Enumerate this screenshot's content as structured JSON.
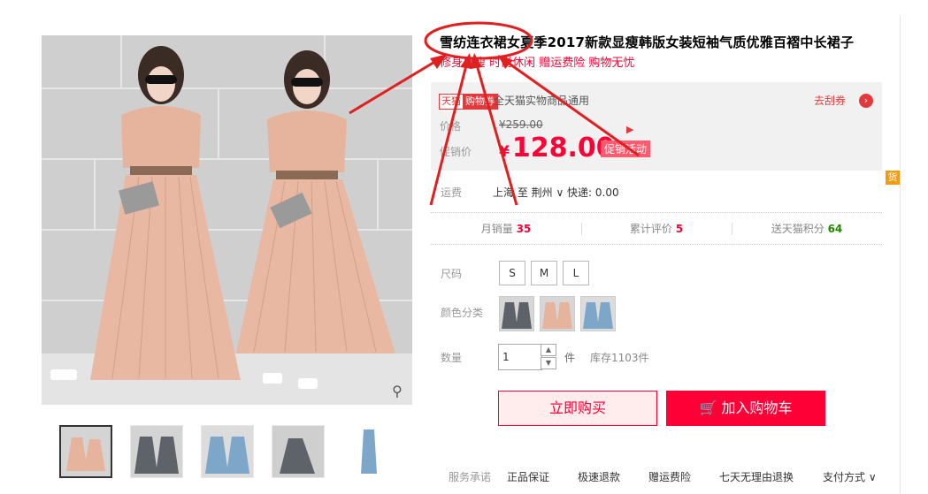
{
  "product": {
    "title": "雪纺连衣裙女夏季2017新款显瘦韩版女装短袖气质优雅百褶中长裙子",
    "subtitle": "修身显瘦 时尚休闲 赠运费险 购物无忧"
  },
  "coupon": {
    "tag_a": "天猫",
    "tag_b": "购物券",
    "text": "全天猫实物商品通用",
    "link": "去刮券"
  },
  "price": {
    "label": "价格",
    "original": "¥259.00",
    "promo_label": "促销价",
    "currency": "¥",
    "promo": "128.00",
    "promo_badge": "促销活动"
  },
  "shipping": {
    "label": "运费",
    "value": "上海 至 荆州 ∨ 快递: 0.00"
  },
  "stats": [
    {
      "label": "月销量",
      "value": "35",
      "color": "#ff0036"
    },
    {
      "label": "累计评价",
      "value": "5",
      "color": "#ff0036"
    },
    {
      "label": "送天猫积分",
      "value": "64",
      "color": "#228800"
    }
  ],
  "sku": {
    "size_label": "尺码",
    "sizes": [
      "S",
      "M",
      "L"
    ],
    "color_label": "颜色分类",
    "qty_label": "数量",
    "qty_value": "1",
    "qty_unit": "件",
    "stock": "库存1103件"
  },
  "actions": {
    "buy_now": "立即购买",
    "add_cart": "加入购物车"
  },
  "services": {
    "label": "服务承诺",
    "items": [
      "正品保证",
      "极速退款",
      "赠运费险",
      "七天无理由退换"
    ],
    "pay": "支付方式 ∨"
  },
  "side_tag": "货",
  "colors": {
    "accent": "#ff0036",
    "dress_pink": "#e7b39c",
    "dress_gray": "#5d6368",
    "dress_blue": "#7ea6c8"
  }
}
